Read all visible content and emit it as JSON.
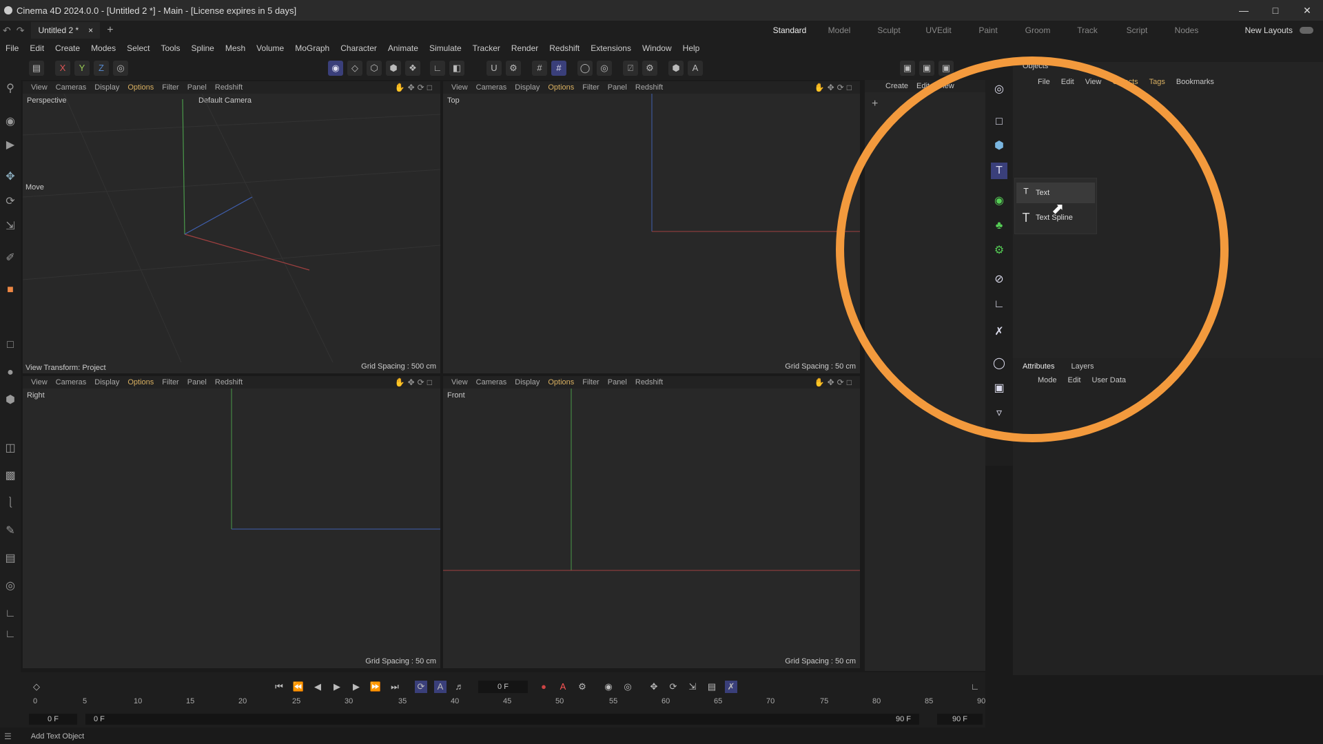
{
  "window": {
    "title": "Cinema 4D 2024.0.0 - [Untitled 2 *] - Main - [License expires in 5 days]"
  },
  "tabs": {
    "doc_tab": "Untitled 2 *",
    "close": "×",
    "add": "+"
  },
  "layouts": {
    "items": [
      "Standard",
      "Model",
      "Sculpt",
      "UVEdit",
      "Paint",
      "Groom",
      "Track",
      "Script",
      "Nodes"
    ],
    "new_layouts": "New Layouts"
  },
  "menu": [
    "File",
    "Edit",
    "Create",
    "Modes",
    "Select",
    "Tools",
    "Spline",
    "Mesh",
    "Volume",
    "MoGraph",
    "Character",
    "Animate",
    "Simulate",
    "Tracker",
    "Render",
    "Redshift",
    "Extensions",
    "Window",
    "Help"
  ],
  "axis_buttons": {
    "x": "X",
    "y": "Y",
    "z": "Z"
  },
  "viewport_menu": [
    "View",
    "Cameras",
    "Display",
    "Options",
    "Filter",
    "Panel",
    "Redshift"
  ],
  "viewports": {
    "perspective": {
      "name": "Perspective",
      "camera": "Default Camera",
      "move": "Move",
      "transform": "View Transform: Project",
      "grid": "Grid Spacing : 500 cm"
    },
    "top": {
      "name": "Top",
      "grid": "Grid Spacing : 50 cm"
    },
    "right": {
      "name": "Right",
      "grid": "Grid Spacing : 50 cm"
    },
    "front": {
      "name": "Front",
      "grid": "Grid Spacing : 50 cm"
    }
  },
  "object_manager_small": {
    "create": "Create",
    "edit": "Edit",
    "view": "View"
  },
  "objects_panel": {
    "title": "Objects",
    "menu": [
      "File",
      "Edit",
      "View",
      "Objects",
      "Tags",
      "Bookmarks"
    ]
  },
  "popup": {
    "items": [
      {
        "label": "Text",
        "icon": "text-3d-icon"
      },
      {
        "label": "Text Spline",
        "icon": "text-spline-icon"
      }
    ]
  },
  "attributes": {
    "tabs": [
      "Attributes",
      "Layers"
    ],
    "menu": [
      "Mode",
      "Edit",
      "User Data"
    ]
  },
  "timeline": {
    "current_frame": "0 F",
    "ruler": [
      "0",
      "5",
      "10",
      "15",
      "20",
      "25",
      "30",
      "35",
      "40",
      "45",
      "50",
      "55",
      "60",
      "65",
      "70",
      "75",
      "80",
      "85",
      "90"
    ],
    "start": "0 F",
    "start2": "0 F",
    "end": "90 F",
    "end2": "90 F"
  },
  "status": {
    "text": "Add Text Object"
  },
  "colors": {
    "accent": "#f39a3d",
    "active_blue": "#3a3f7a",
    "options": "#d9b061"
  }
}
